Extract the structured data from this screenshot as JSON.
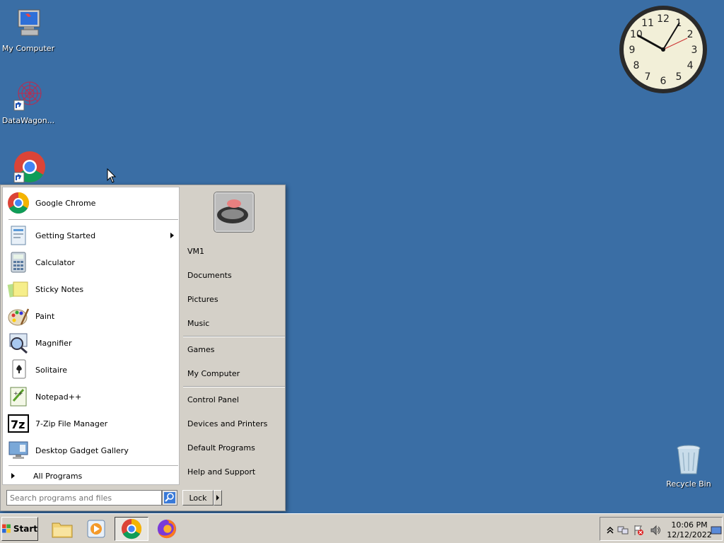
{
  "desktop": {
    "icons": [
      {
        "label": "My Computer"
      },
      {
        "label": "DataWagon..."
      },
      {
        "label": "Google Chrome"
      },
      {
        "label": "Recycle Bin"
      }
    ]
  },
  "clock_gadget": {
    "numerals": [
      "12",
      "1",
      "2",
      "3",
      "4",
      "5",
      "6",
      "7",
      "8",
      "9",
      "10",
      "11"
    ]
  },
  "start_menu": {
    "pinned": [
      {
        "label": "Google Chrome",
        "icon": "chrome-icon"
      }
    ],
    "recent": [
      {
        "label": "Getting Started",
        "icon": "getting-started-icon",
        "submenu": true
      },
      {
        "label": "Calculator",
        "icon": "calculator-icon"
      },
      {
        "label": "Sticky Notes",
        "icon": "sticky-notes-icon"
      },
      {
        "label": "Paint",
        "icon": "paint-icon"
      },
      {
        "label": "Magnifier",
        "icon": "magnifier-icon"
      },
      {
        "label": "Solitaire",
        "icon": "solitaire-icon"
      },
      {
        "label": "Notepad++",
        "icon": "notepadpp-icon"
      },
      {
        "label": "7-Zip File Manager",
        "icon": "7zip-icon"
      },
      {
        "label": "Desktop Gadget Gallery",
        "icon": "gadget-gallery-icon"
      }
    ],
    "all_programs": "All Programs",
    "right": {
      "group1": [
        "VM1",
        "Documents",
        "Pictures",
        "Music"
      ],
      "group2": [
        "Games",
        "My Computer"
      ],
      "group3": [
        "Control Panel",
        "Devices and Printers",
        "Default Programs",
        "Help and Support"
      ]
    },
    "search": {
      "placeholder": "Search programs and files"
    },
    "lock_label": "Lock"
  },
  "taskbar": {
    "start_label": "Start",
    "time": "10:06 PM",
    "date": "12/12/2022"
  }
}
